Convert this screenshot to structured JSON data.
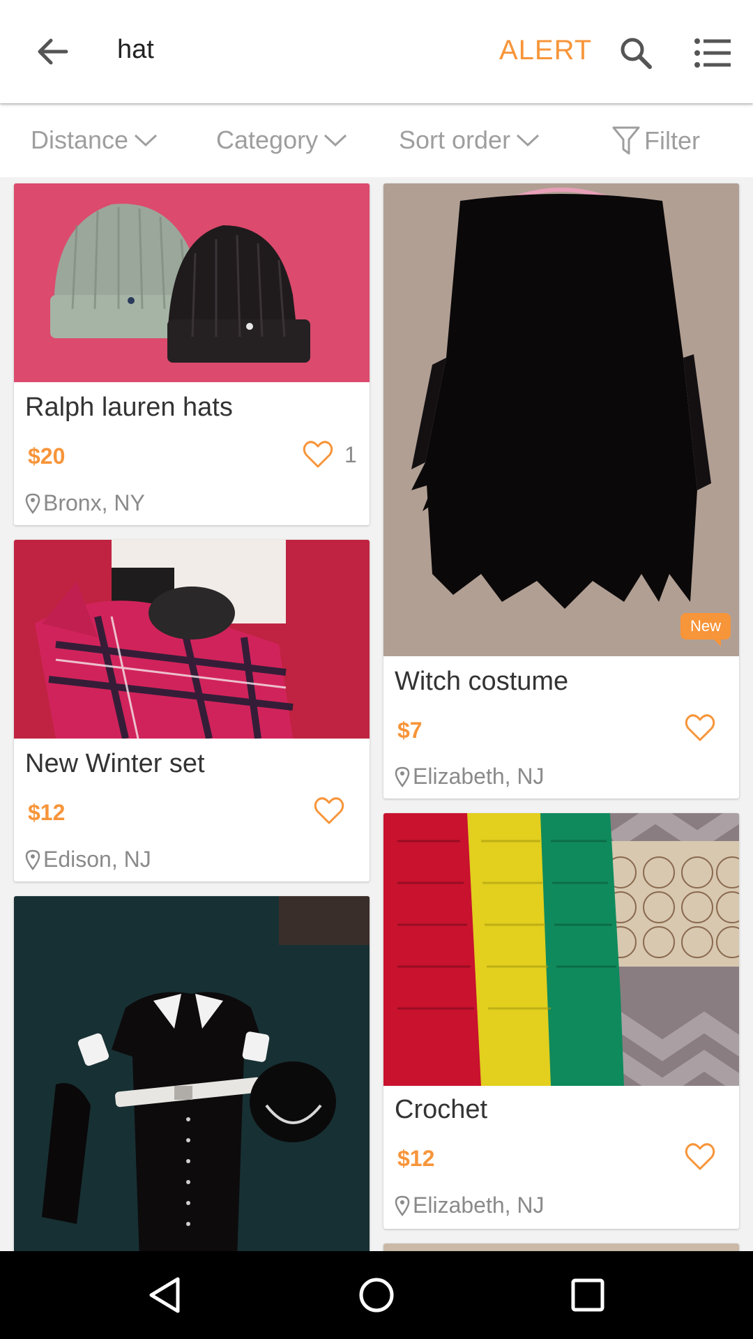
{
  "header": {
    "query": "hat",
    "alert_label": "ALERT",
    "back_icon": "arrow-left-icon",
    "search_icon": "search-icon",
    "menu_icon": "list-view-icon"
  },
  "filters": {
    "distance": "Distance",
    "category": "Category",
    "sort": "Sort order",
    "filter": "Filter"
  },
  "colors": {
    "accent": "#f7953a",
    "muted": "#8a8a8a",
    "background": "#f2f2f2"
  },
  "listings": [
    {
      "title": "Ralph lauren hats",
      "price": "$20",
      "likes": "1",
      "location": "Bronx, NY"
    },
    {
      "title": "Witch costume",
      "price": "$7",
      "location": "Elizabeth, NJ",
      "badge": "New"
    },
    {
      "title": "New Winter set",
      "price": "$12",
      "location": "Edison, NJ"
    },
    {
      "title": "Crochet",
      "price": "$12",
      "location": "Elizabeth, NJ"
    }
  ],
  "navbar": {
    "back": "nav-back-icon",
    "home": "nav-home-icon",
    "recents": "nav-recents-icon"
  }
}
